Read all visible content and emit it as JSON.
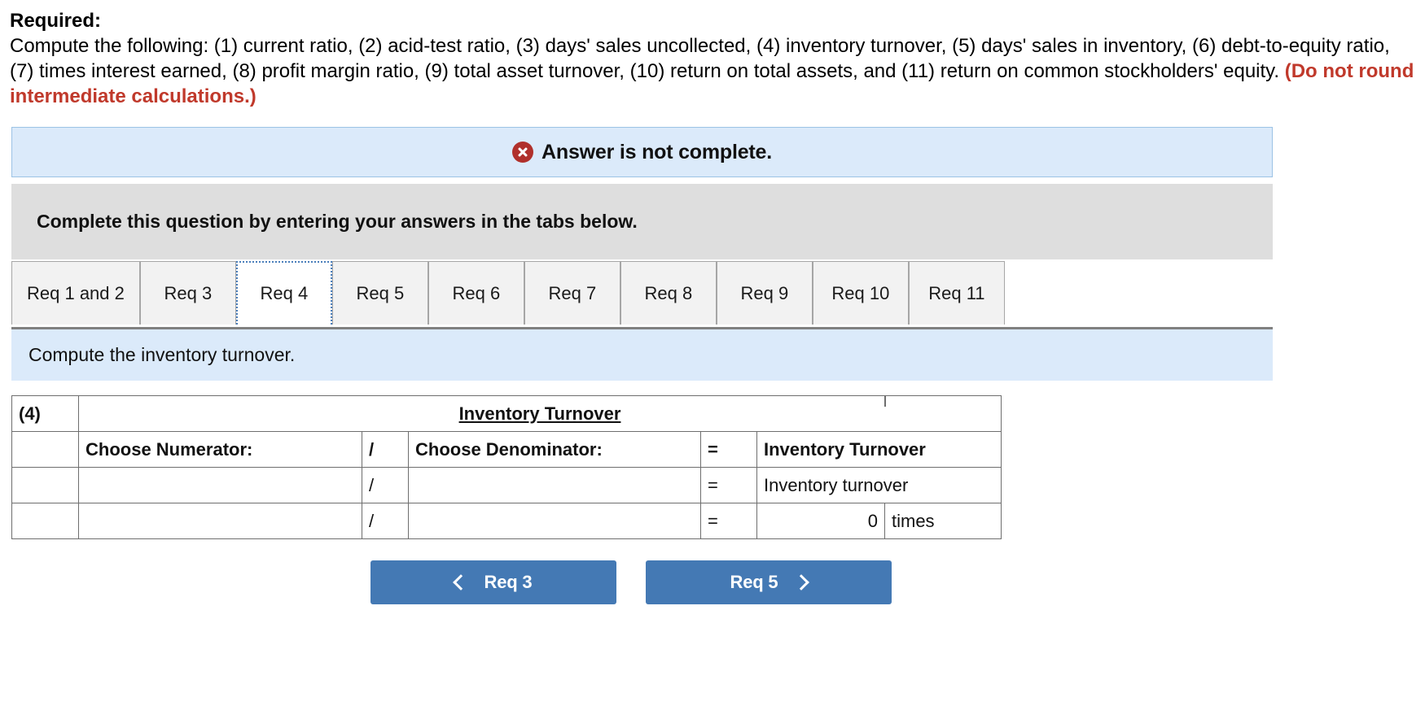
{
  "prompt": {
    "title": "Required:",
    "body": "Compute the following: (1) current ratio, (2) acid-test ratio, (3) days' sales uncollected, (4) inventory turnover, (5) days' sales in inventory, (6) debt-to-equity ratio, (7) times interest earned, (8) profit margin ratio, (9) total asset turnover, (10) return on total assets, and (11) return on common stockholders' equity.",
    "note": "(Do not round intermediate calculations.)"
  },
  "alert": {
    "icon": "error-x-icon",
    "text": "Answer is not complete.",
    "bg_color": "#dbeafa",
    "border_color": "#9cc3e5",
    "icon_color": "#b0302b"
  },
  "instruction_box": {
    "text": "Complete this question by entering your answers in the tabs below.",
    "bg_color": "#dedede"
  },
  "tabs": {
    "items": [
      {
        "label": "Req 1 and 2",
        "active": false
      },
      {
        "label": "Req 3",
        "active": false
      },
      {
        "label": "Req 4",
        "active": true
      },
      {
        "label": "Req 5",
        "active": false
      },
      {
        "label": "Req 6",
        "active": false
      },
      {
        "label": "Req 7",
        "active": false
      },
      {
        "label": "Req 8",
        "active": false
      },
      {
        "label": "Req 9",
        "active": false
      },
      {
        "label": "Req 10",
        "active": false
      },
      {
        "label": "Req 11",
        "active": false
      }
    ]
  },
  "question_strip": {
    "text": "Compute the inventory turnover."
  },
  "answer_table": {
    "header_color": "#7da7dd",
    "index_label": "(4)",
    "title": "Inventory Turnover",
    "columns": {
      "numerator": "Choose Numerator:",
      "slash": "/",
      "denominator": "Choose Denominator:",
      "equals": "=",
      "result": "Inventory Turnover"
    },
    "rows": [
      {
        "index": "",
        "numerator": "",
        "slash": "/",
        "denominator": "",
        "equals": "=",
        "result": "Inventory turnover",
        "unit": ""
      },
      {
        "index": "",
        "numerator": "",
        "slash": "/",
        "denominator": "",
        "equals": "=",
        "result": "0",
        "unit": "times"
      }
    ]
  },
  "nav": {
    "prev_label": "Req 3",
    "next_label": "Req 5",
    "prev_icon": "chevron-left-icon",
    "next_icon": "chevron-right-icon",
    "button_color": "#4479b4"
  }
}
